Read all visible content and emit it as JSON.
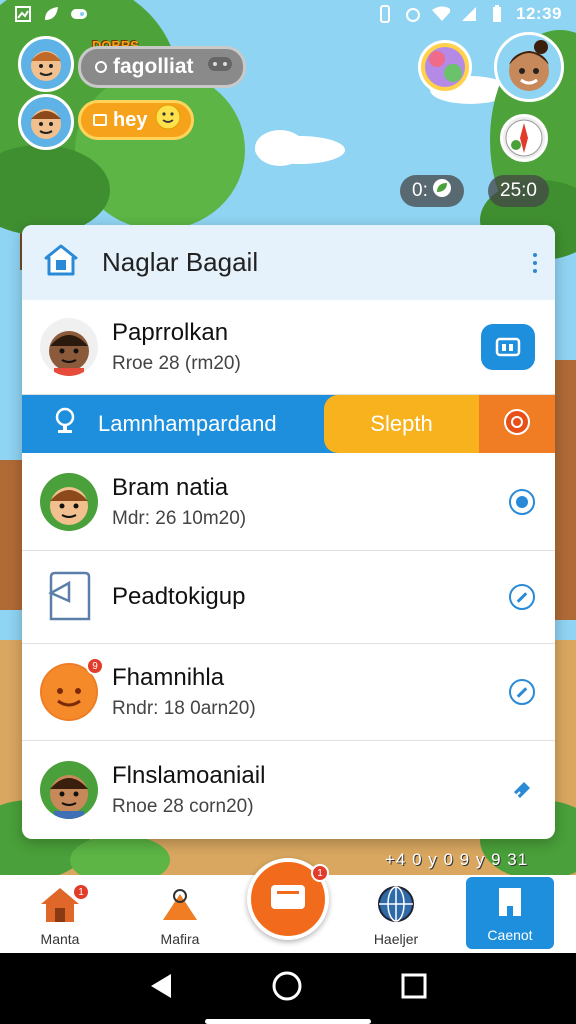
{
  "status_bar": {
    "time": "12:39"
  },
  "top": {
    "badge_label": "DOBRS",
    "status_pill_text": "fagolliat",
    "message_pill_text": "hey",
    "counter_left": "0:",
    "counter_right": "25:0"
  },
  "card": {
    "title": "Naglar Bagail",
    "rows": [
      {
        "name": "Paprrolkan",
        "sub": "Rroe 28 (rm20)"
      },
      {
        "name": "Bram natia",
        "sub": "Mdr: 26 10m20)"
      },
      {
        "name": "Peadtokigup",
        "sub": ""
      },
      {
        "name": "Fhamnihla",
        "sub": "Rndr: 18 0arn20)"
      },
      {
        "name": "Flnslamoaniail",
        "sub": "Rnoe 28 corn20)"
      }
    ],
    "banner": {
      "left_label": "Lamnhampardand",
      "mid_label": "Slepth"
    }
  },
  "ground_text": "+4 0 y 0 9  y 9 31",
  "bottom_nav": {
    "items": [
      {
        "label": "Manta"
      },
      {
        "label": "Mafira"
      },
      {
        "label": "Haeljer"
      },
      {
        "label": "Caenot"
      }
    ],
    "badges": [
      "1",
      "1",
      "1"
    ],
    "row_badge": "9"
  },
  "colors": {
    "accent": "#1e8fdc",
    "orange": "#f26a1b",
    "yellow": "#f7b21e"
  }
}
